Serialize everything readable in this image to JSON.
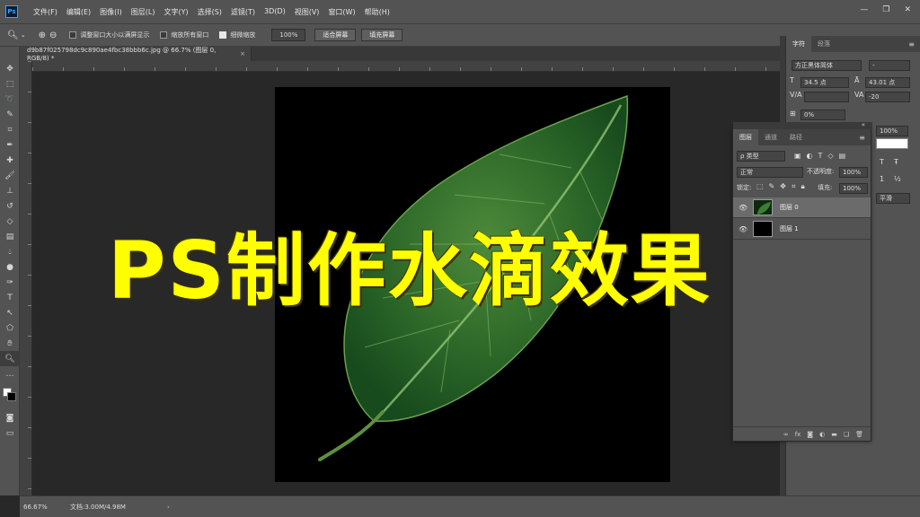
{
  "app": {
    "logo": "Ps"
  },
  "menu": [
    "文件(F)",
    "编辑(E)",
    "图像(I)",
    "图层(L)",
    "文字(Y)",
    "选择(S)",
    "滤镜(T)",
    "3D(D)",
    "视图(V)",
    "窗口(W)",
    "帮助(H)"
  ],
  "window_controls": [
    "—",
    "❐",
    "✕"
  ],
  "options": {
    "resize_window": "调整窗口大小以满屏显示",
    "zoom_all": "缩放所有窗口",
    "scrubby_zoom": "细微缩放",
    "zoom_value": "100%",
    "fit_screen": "适合屏幕",
    "fill_screen": "填充屏幕"
  },
  "document": {
    "tab": "d9b87f025798dc9c890ae4fbc38bbb6c.jpg @ 66.7% (图层 0, RGB/8) *",
    "close": "×"
  },
  "status": {
    "zoom": "66.67%",
    "doc": "文档:3.00M/4.98M",
    "arrow": "›"
  },
  "character_panel": {
    "tabs": [
      "字符",
      "段落"
    ],
    "font_family": "方正黑体简体",
    "font_style": "-",
    "font_size": "34.5 点",
    "leading": "43.01 点",
    "kerning": "",
    "tracking": "-20",
    "vertical_scale": "0%",
    "horizontal_scale": "100%",
    "anti_alias": "平滑"
  },
  "layers_panel": {
    "tabs": [
      "图层",
      "通道",
      "路径"
    ],
    "filter": "ρ 类型",
    "blend_mode": "正常",
    "opacity_label": "不透明度:",
    "opacity": "100%",
    "lock_label": "锁定:",
    "fill_label": "填充:",
    "fill": "100%",
    "layers": [
      {
        "name": "图层 0",
        "selected": true
      },
      {
        "name": "图层 1",
        "selected": false
      }
    ]
  },
  "overlay_title": "PS制作水滴效果"
}
